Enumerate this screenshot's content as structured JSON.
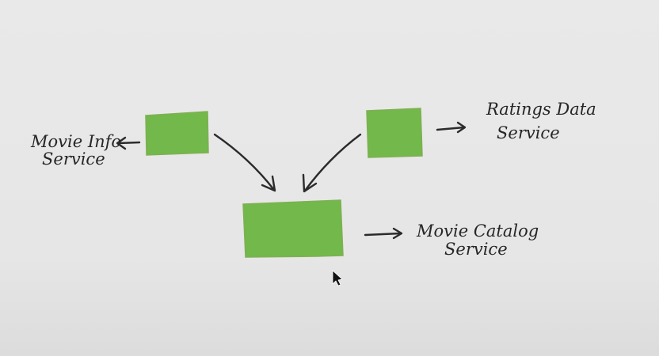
{
  "diagram": {
    "colors": {
      "background": "#e8e8e8",
      "box_fill": "#72b84b",
      "ink": "#262626"
    },
    "nodes": [
      {
        "id": "movie-info-service",
        "label_lines": [
          "Movie Info",
          "Service"
        ]
      },
      {
        "id": "ratings-data-service",
        "label_lines": [
          "Ratings Data",
          "Service"
        ]
      },
      {
        "id": "movie-catalog-service",
        "label_lines": [
          "Movie Catalog",
          "Service"
        ]
      }
    ],
    "edges": [
      {
        "from": "movie-info-service",
        "to": "movie-catalog-service"
      },
      {
        "from": "ratings-data-service",
        "to": "movie-catalog-service"
      }
    ],
    "cursor": {
      "icon": "mouse-pointer-icon"
    }
  }
}
